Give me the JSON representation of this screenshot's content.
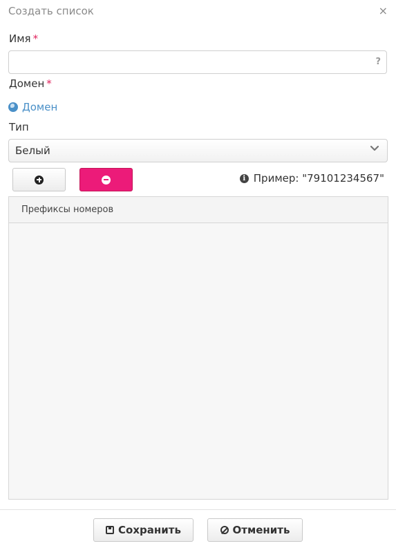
{
  "dialog": {
    "title": "Создать список",
    "close_icon": "×"
  },
  "form": {
    "name": {
      "label": "Имя",
      "required_mark": "*",
      "value": "",
      "placeholder": "",
      "help_icon": "?"
    },
    "domain": {
      "label": "Домен",
      "required_mark": "*",
      "link_text": "Домен",
      "icon": "globe-icon"
    },
    "type": {
      "label": "Тип",
      "selected": "Белый"
    }
  },
  "toolbar": {
    "add_icon": "plus-circle-icon",
    "remove_icon": "minus-circle-icon",
    "example_text": "Пример: \"79101234567\"",
    "info_icon": "i"
  },
  "table": {
    "columns": [
      "Префиксы номеров"
    ],
    "rows": []
  },
  "footer": {
    "save_label": "Сохранить",
    "cancel_label": "Отменить"
  },
  "colors": {
    "accent_link": "#4a90c8",
    "required": "#e0245e",
    "danger_button": "#ec1b79"
  }
}
